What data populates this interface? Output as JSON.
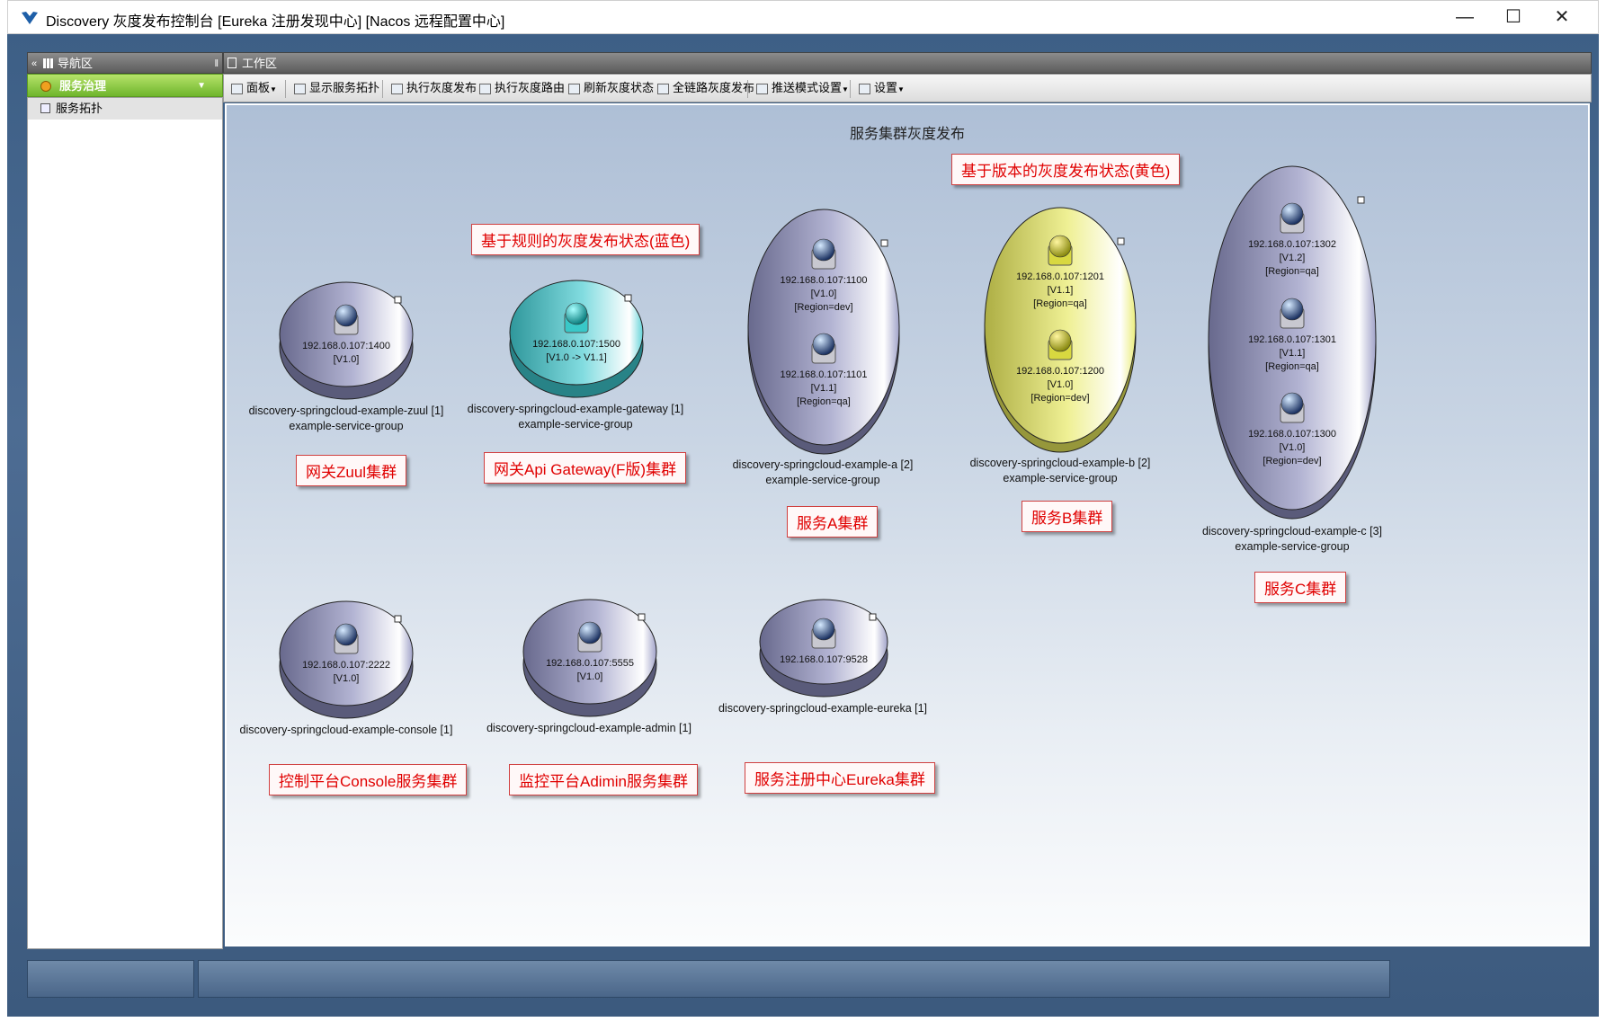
{
  "window": {
    "title": "Discovery 灰度发布控制台 [Eureka 注册发现中心] [Nacos 远程配置中心]"
  },
  "nav": {
    "header": "导航区",
    "group": "服务治理",
    "items": [
      {
        "label": "服务拓扑"
      }
    ]
  },
  "work": {
    "header": "工作区",
    "toolbar": [
      {
        "label": "面板",
        "icon": "panel-icon",
        "dropdown": true
      },
      {
        "label": "显示服务拓扑",
        "icon": "topology-icon"
      },
      {
        "label": "执行灰度发布",
        "icon": "release-icon"
      },
      {
        "label": "执行灰度路由",
        "icon": "route-icon"
      },
      {
        "label": "刷新灰度状态",
        "icon": "refresh-icon"
      },
      {
        "label": "全链路灰度发布",
        "icon": "full-link-icon"
      },
      {
        "label": "推送模式设置",
        "icon": "push-mode-icon",
        "dropdown": true
      },
      {
        "label": "设置",
        "icon": "settings-icon",
        "dropdown": true
      }
    ],
    "canvas_title": "服务集群灰度发布"
  },
  "colors": {
    "default": "#8a8cbc",
    "rule_blue": "#3ec9cf",
    "version_yellow": "#e6e85a",
    "callout_text": "#e00000"
  },
  "clusters": [
    {
      "name": "discovery-springcloud-example-zuul [1]",
      "group": "example-service-group",
      "color": "default",
      "instances": [
        {
          "address": "192.168.0.107:1400",
          "version": "[V1.0]"
        }
      ]
    },
    {
      "name": "discovery-springcloud-example-gateway [1]",
      "group": "example-service-group",
      "color": "rule_blue",
      "instances": [
        {
          "address": "192.168.0.107:1500",
          "version": "[V1.0 -> V1.1]"
        }
      ]
    },
    {
      "name": "discovery-springcloud-example-a [2]",
      "group": "example-service-group",
      "color": "default",
      "instances": [
        {
          "address": "192.168.0.107:1100",
          "version": "[V1.0]",
          "region": "[Region=dev]"
        },
        {
          "address": "192.168.0.107:1101",
          "version": "[V1.1]",
          "region": "[Region=qa]"
        }
      ]
    },
    {
      "name": "discovery-springcloud-example-b [2]",
      "group": "example-service-group",
      "color": "version_yellow",
      "instances": [
        {
          "address": "192.168.0.107:1201",
          "version": "[V1.1]",
          "region": "[Region=qa]"
        },
        {
          "address": "192.168.0.107:1200",
          "version": "[V1.0]",
          "region": "[Region=dev]"
        }
      ]
    },
    {
      "name": "discovery-springcloud-example-c [3]",
      "group": "example-service-group",
      "color": "default",
      "instances": [
        {
          "address": "192.168.0.107:1302",
          "version": "[V1.2]",
          "region": "[Region=qa]"
        },
        {
          "address": "192.168.0.107:1301",
          "version": "[V1.1]",
          "region": "[Region=qa]"
        },
        {
          "address": "192.168.0.107:1300",
          "version": "[V1.0]",
          "region": "[Region=dev]"
        }
      ]
    },
    {
      "name": "discovery-springcloud-example-console [1]",
      "color": "default",
      "instances": [
        {
          "address": "192.168.0.107:2222",
          "version": "[V1.0]"
        }
      ]
    },
    {
      "name": "discovery-springcloud-example-admin [1]",
      "color": "default",
      "instances": [
        {
          "address": "192.168.0.107:5555",
          "version": "[V1.0]"
        }
      ]
    },
    {
      "name": "discovery-springcloud-example-eureka [1]",
      "color": "default",
      "instances": [
        {
          "address": "192.168.0.107:9528"
        }
      ]
    }
  ],
  "callouts": {
    "rule_state": "基于规则的灰度发布状态(蓝色)",
    "version_state": "基于版本的灰度发布状态(黄色)",
    "zuul": "网关Zuul集群",
    "gateway": "网关Api Gateway(F版)集群",
    "service_a": "服务A集群",
    "service_b": "服务B集群",
    "service_c": "服务C集群",
    "console": "控制平台Console服务集群",
    "admin": "监控平台Adimin服务集群",
    "eureka": "服务注册中心Eureka集群"
  }
}
